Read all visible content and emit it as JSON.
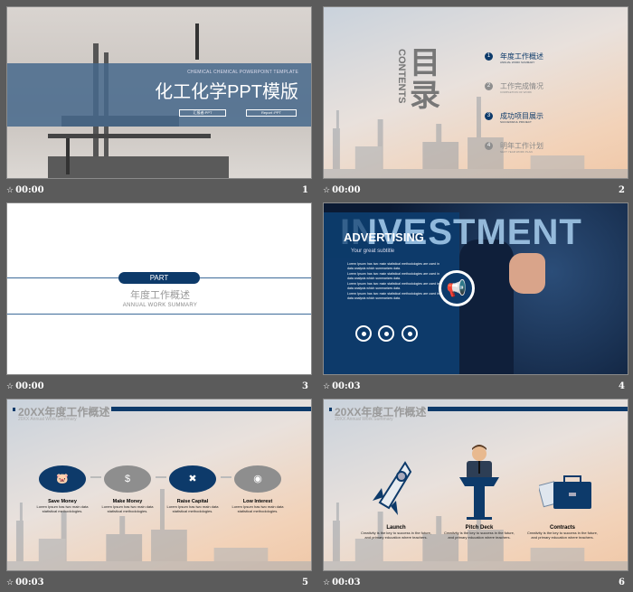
{
  "slides": [
    {
      "number": "1",
      "time": "00:00",
      "subtitle": "CHEMICAL CHEMICAL POWERPOINT TEMPLATE",
      "title": "化工化学PPT模版",
      "button1": "汇报者:PPT",
      "button2": "Report :PPT"
    },
    {
      "number": "2",
      "time": "00:00",
      "title": "目录",
      "title_en": "CONTENTS",
      "items": [
        {
          "num": "1",
          "cn": "年度工作概述",
          "en": "ANNUAL WORK SUMMARY"
        },
        {
          "num": "2",
          "cn": "工作完成情况",
          "en": "COMPLETION OF WORK"
        },
        {
          "num": "3",
          "cn": "成功项目展示",
          "en": "SUCCESSFUL PROJECT"
        },
        {
          "num": "4",
          "cn": "明年工作计划",
          "en": "NEXT YEAR WORK PLAN"
        }
      ]
    },
    {
      "number": "3",
      "time": "00:00",
      "badge": "PART",
      "title": "年度工作概述",
      "subtitle": "ANNUAL WORK SUMMARY"
    },
    {
      "number": "4",
      "time": "00:03",
      "bg_word": "INVESTMENT",
      "title": "ADVERTISING",
      "subtitle": "Your great subtitle",
      "body": "Lorem Ipsum has two main statistical methodologies are used in data analysis which summarizes data."
    },
    {
      "number": "5",
      "time": "00:03",
      "header": "20XX年度工作概述",
      "header_en": "20XX Annual Work Summary",
      "steps": [
        {
          "title": "Save Money",
          "text": "Lorem Ipsum has two main data statistical methodologies."
        },
        {
          "title": "Make Money",
          "text": "Lorem Ipsum has two main data statistical methodologies."
        },
        {
          "title": "Raise Capital",
          "text": "Lorem Ipsum has two main data statistical methodologies."
        },
        {
          "title": "Low Interest",
          "text": "Lorem Ipsum has two main data statistical methodologies."
        }
      ]
    },
    {
      "number": "6",
      "time": "00:03",
      "header": "20XX年度工作概述",
      "header_en": "20XX Annual Work Summary",
      "items": [
        {
          "title": "Launch",
          "text": "Creativity is the key to success in the future, and primary education where teachers."
        },
        {
          "title": "Pitch Deck",
          "text": "Creativity is the key to success in the future, and primary education where teachers."
        },
        {
          "title": "Contracts",
          "text": "Creativity is the key to success in the future, and primary education where teachers."
        }
      ]
    }
  ],
  "colors": {
    "navy": "#0d3a6a",
    "band": "#4f7091",
    "gray": "#8e8e8e"
  }
}
